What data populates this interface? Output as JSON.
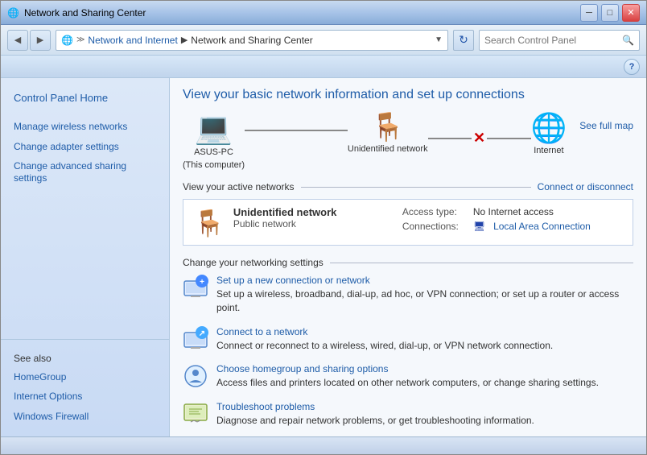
{
  "window": {
    "title": "Network and Sharing Center",
    "controls": {
      "minimize": "─",
      "maximize": "□",
      "close": "✕"
    }
  },
  "navbar": {
    "icon": "🌐",
    "breadcrumb": {
      "separator": "≫",
      "items": [
        "Network and Internet",
        "Network and Sharing Center"
      ]
    },
    "go_button": "⟳",
    "search_placeholder": "Search Control Panel"
  },
  "help_button": "?",
  "sidebar": {
    "title": "Control Panel Home",
    "items": [
      {
        "label": "Manage wireless networks",
        "id": "manage-wireless"
      },
      {
        "label": "Change adapter settings",
        "id": "change-adapter"
      },
      {
        "label": "Change advanced sharing settings",
        "id": "change-advanced"
      }
    ],
    "see_also_label": "See also",
    "see_also_items": [
      {
        "label": "HomeGroup",
        "id": "homegroup"
      },
      {
        "label": "Internet Options",
        "id": "internet-options"
      },
      {
        "label": "Windows Firewall",
        "id": "windows-firewall"
      }
    ]
  },
  "main": {
    "title": "View your basic network information and set up connections",
    "diagram": {
      "nodes": [
        {
          "label": "ASUS-PC",
          "sublabel": "(This computer)",
          "icon": "💻"
        },
        {
          "label": "Unidentified network",
          "icon": "🪑"
        },
        {
          "label": "Internet",
          "icon": "🌐"
        }
      ],
      "see_full_map": "See full map"
    },
    "active_networks": {
      "section_label": "View your active networks",
      "connect_disconnect": "Connect or disconnect",
      "network_name": "Unidentified network",
      "network_type": "Public network",
      "access_type_label": "Access type:",
      "access_type_value": "No Internet access",
      "connections_label": "Connections:",
      "connections_value": "Local Area Connection"
    },
    "networking_settings": {
      "section_label": "Change your networking settings",
      "items": [
        {
          "id": "new-connection",
          "link": "Set up a new connection or network",
          "desc": "Set up a wireless, broadband, dial-up, ad hoc, or VPN connection; or set up a router or access point."
        },
        {
          "id": "connect-to-network",
          "link": "Connect to a network",
          "desc": "Connect or reconnect to a wireless, wired, dial-up, or VPN network connection."
        },
        {
          "id": "homegroup-sharing",
          "link": "Choose homegroup and sharing options",
          "desc": "Access files and printers located on other network computers, or change sharing settings."
        },
        {
          "id": "troubleshoot",
          "link": "Troubleshoot problems",
          "desc": "Diagnose and repair network problems, or get troubleshooting information."
        }
      ]
    }
  },
  "colors": {
    "link": "#1e5ca8",
    "accent": "#c8daf4",
    "window_chrome": "#a8c4e8"
  }
}
